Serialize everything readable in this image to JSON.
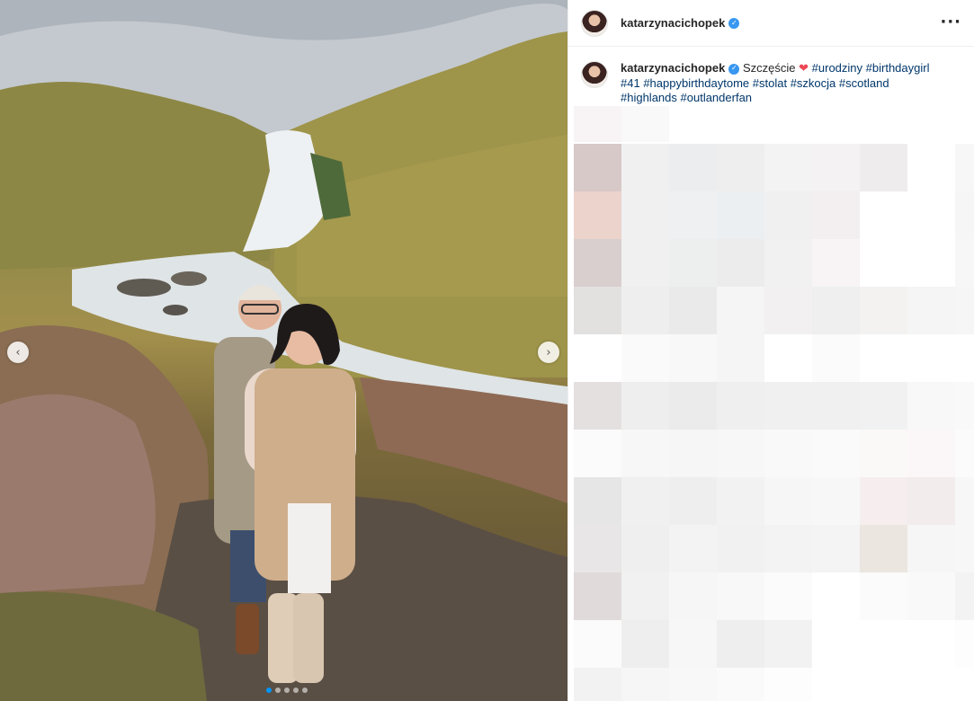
{
  "post": {
    "username": "katarzynacichopek",
    "verified": true,
    "more_icon": "more-horizontal-icon"
  },
  "caption": {
    "username": "katarzynacichopek",
    "text": "Szczęście",
    "emoji": "❤",
    "hashtags": [
      "#urodziny",
      "#birthdaygirl",
      "#41",
      "#happybirthdaytome",
      "#stolat",
      "#szkocja",
      "#scotland",
      "#highlands",
      "#outlanderfan"
    ]
  },
  "carousel": {
    "prev_icon": "chevron-left-icon",
    "next_icon": "chevron-right-icon",
    "prev_glyph": "‹",
    "next_glyph": "›",
    "slide_count": 5,
    "active_slide": 1
  },
  "colors": {
    "verified_blue": "#3897f0",
    "hashtag": "#00376b",
    "heart": "#ed4956"
  },
  "blur_cells": [
    "#d7c9c8",
    "#f0f0f0",
    "#ecedef",
    "#eeeeee",
    "#f3f3f3",
    "#f4f2f3",
    "#efeced",
    "#ffffff",
    "#f7f7f7",
    "#ecd3cc",
    "#f1f0f1",
    "#eef0f1",
    "#eceff2",
    "#f0f0f0",
    "#f3eff0",
    "#ffffff",
    "#ffffff",
    "#f6f6f6",
    "#d9cfcf",
    "#f1f0f0",
    "#edeeee",
    "#ececec",
    "#f2f1f1",
    "#f8f3f4",
    "#ffffff",
    "#ffffff",
    "#f7f7f7",
    "#e3e0e0",
    "#efeeee",
    "#eaeaea",
    "#f5f5f5",
    "#f2f0f0",
    "#efefef",
    "#f3f2f0",
    "#f5f5f5",
    "#f6f6f6",
    "#ffffff",
    "#fafafa",
    "#f8f8f8",
    "#f5f5f5",
    "#ffffff",
    "#fbfbfb",
    "#ffffff",
    "#ffffff",
    "#ffffff",
    "#e4e0e0",
    "#eeeeee",
    "#ebebeb",
    "#efefef",
    "#f0f0f0",
    "#f0f0f0",
    "#f1f1f1",
    "#f8f8f8",
    "#f9f9f9",
    "#fbfbfb",
    "#f7f7f7",
    "#f6f6f6",
    "#f7f7f7",
    "#f9f9f9",
    "#fafafa",
    "#fbf8f8",
    "#fbf6f7",
    "#fbfbfb",
    "#e6e6e6",
    "#f0f0f0",
    "#eeeeee",
    "#f2f2f2",
    "#f6f6f6",
    "#f7f7f7",
    "#f6eeee",
    "#f2ecec",
    "#f7f7f7",
    "#e8e6e6",
    "#efefef",
    "#f3f3f3",
    "#f1f1f1",
    "#f3f3f3",
    "#f4f4f4",
    "#ebe6e0",
    "#f6f6f6",
    "#f7f7f7",
    "#e0dada",
    "#f1f1f1",
    "#f6f6f6",
    "#f8f8f8",
    "#fbfbfb",
    "#ffffff",
    "#fbfbfb",
    "#f9f9f9",
    "#f3f3f3",
    "#fbfbfb",
    "#eeeeee",
    "#f7f7f7",
    "#eeeeee",
    "#f2f2f2",
    "#ffffff",
    "#ffffff",
    "#ffffff",
    "#fdfdfd",
    "#f2f2f2",
    "#f6f6f6",
    "#f8f8f8",
    "#fafafa",
    "#fdfdfd",
    "#ffffff",
    "#ffffff",
    "#ffffff",
    "#ffffff"
  ]
}
